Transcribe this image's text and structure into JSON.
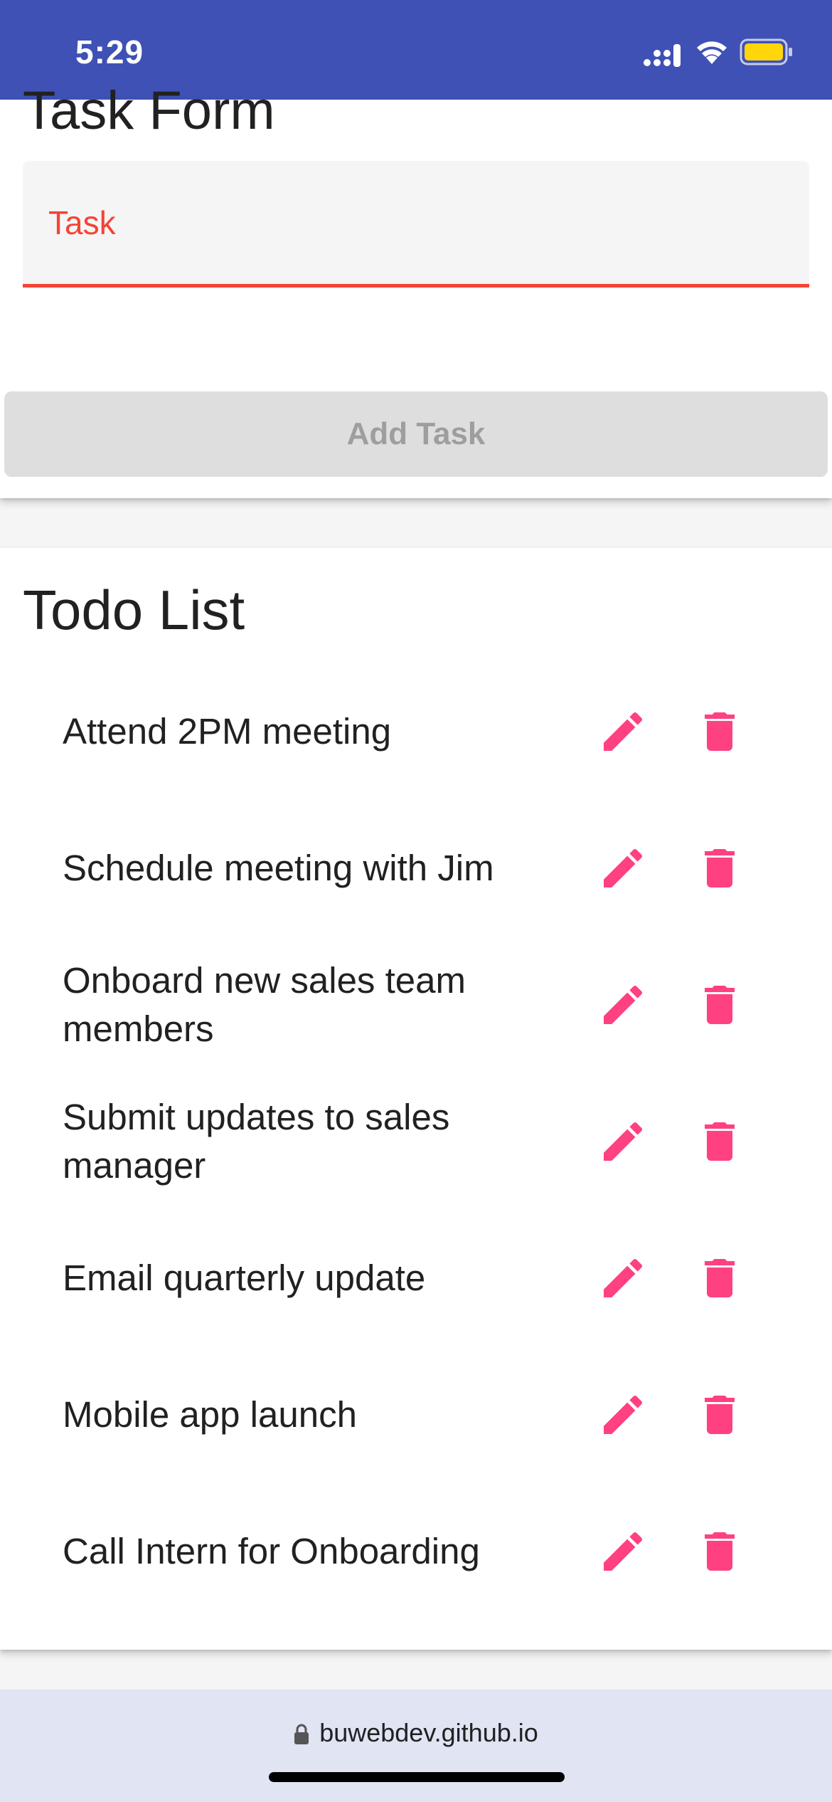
{
  "status_bar": {
    "time": "5:29",
    "signal_icon": "cellular-signal-icon",
    "wifi_icon": "wifi-icon",
    "battery_icon": "battery-icon",
    "background": "#3f51b5",
    "battery_color": "#ffd60a"
  },
  "task_form": {
    "title": "Task Form",
    "task_input_label": "Task",
    "task_input_value": "",
    "add_button_label": "Add Task"
  },
  "todo_list": {
    "title": "Todo List",
    "items": [
      {
        "label": "Attend 2PM meeting"
      },
      {
        "label": "Schedule meeting with Jim"
      },
      {
        "label": "Onboard new sales team members"
      },
      {
        "label": "Submit updates to sales manager"
      },
      {
        "label": "Email quarterly update"
      },
      {
        "label": "Mobile app launch"
      },
      {
        "label": "Call Intern for Onboarding"
      }
    ],
    "edit_icon": "pencil-icon",
    "delete_icon": "trash-icon",
    "icon_color": "#ff4081"
  },
  "browser": {
    "url": "buwebdev.github.io",
    "lock_icon": "lock-icon"
  },
  "colors": {
    "error": "#f44336",
    "primary": "#3f51b5",
    "accent": "#ff4081"
  }
}
